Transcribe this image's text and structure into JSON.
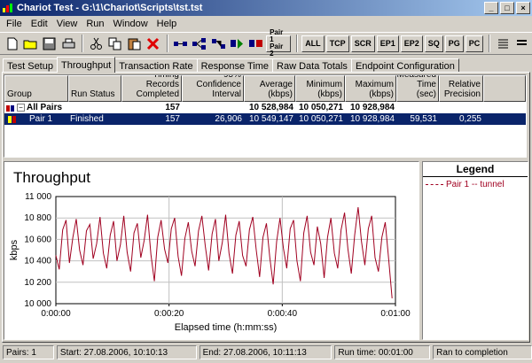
{
  "window": {
    "title": "Chariot Test - G:\\1\\Chariot\\Scripts\\tst.tst"
  },
  "menu": [
    "File",
    "Edit",
    "View",
    "Run",
    "Window",
    "Help"
  ],
  "toolbar": {
    "text_buttons": [
      "ALL",
      "TCP",
      "SCR",
      "EP1",
      "EP2",
      "SQ",
      "PG",
      "PC"
    ],
    "pair_label_1": "Pair 1",
    "pair_label_2": "Pair 2"
  },
  "tabs": [
    "Test Setup",
    "Throughput",
    "Transaction Rate",
    "Response Time",
    "Raw Data Totals",
    "Endpoint Configuration"
  ],
  "active_tab": "Throughput",
  "grid": {
    "headers": [
      "Group",
      "Run Status",
      "Timing Records Completed",
      "95% Confidence Interval",
      "Average (kbps)",
      "Minimum (kbps)",
      "Maximum (kbps)",
      "Measured Time (sec)",
      "Relative Precision"
    ],
    "total_row": {
      "group": "All Pairs",
      "run_status": "",
      "records": "157",
      "confidence": "",
      "average": "10 528,984",
      "minimum": "10 050,271",
      "maximum": "10 928,984",
      "measured": "",
      "precision": ""
    },
    "rows": [
      {
        "group": "Pair 1",
        "run_status": "Finished",
        "records": "157",
        "confidence": "26,906",
        "average": "10 549,147",
        "minimum": "10 050,271",
        "maximum": "10 928,984",
        "measured": "59,531",
        "precision": "0,255"
      }
    ]
  },
  "chart": {
    "title": "Throughput",
    "legend_title": "Legend",
    "line_color": "#a00020"
  },
  "chart_data": {
    "type": "line",
    "title": "Throughput",
    "xlabel": "Elapsed time (h:mm:ss)",
    "ylabel": "kbps",
    "ylim": [
      10000,
      11000
    ],
    "xlim": [
      0,
      60
    ],
    "yticks": [
      "11 000",
      "10 800",
      "10 600",
      "10 400",
      "10 200",
      "10 000"
    ],
    "xticks": [
      "0:00:00",
      "0:00:20",
      "0:00:40",
      "0:01:00"
    ],
    "grid": true,
    "series": [
      {
        "name": "Pair 1 -- tunnel",
        "x": [
          0.0,
          0.6,
          1.2,
          1.8,
          2.4,
          3.0,
          3.6,
          4.2,
          4.8,
          5.4,
          6.0,
          6.6,
          7.2,
          7.8,
          8.4,
          9.0,
          9.6,
          10.2,
          10.8,
          11.4,
          12.0,
          12.6,
          13.2,
          13.8,
          14.4,
          15.0,
          15.6,
          16.2,
          16.8,
          17.4,
          18.0,
          18.6,
          19.2,
          19.8,
          20.4,
          21.0,
          21.6,
          22.2,
          22.8,
          23.4,
          24.0,
          24.6,
          25.2,
          25.8,
          26.4,
          27.0,
          27.6,
          28.2,
          28.8,
          29.4,
          30.0,
          30.6,
          31.2,
          31.8,
          32.4,
          33.0,
          33.6,
          34.2,
          34.8,
          35.4,
          36.0,
          36.6,
          37.2,
          37.8,
          38.4,
          39.0,
          39.6,
          40.2,
          40.8,
          41.4,
          42.0,
          42.6,
          43.2,
          43.8,
          44.4,
          45.0,
          45.6,
          46.2,
          46.8,
          47.4,
          48.0,
          48.6,
          49.2,
          49.8,
          50.4,
          51.0,
          51.6,
          52.2,
          52.8,
          53.4,
          54.0,
          54.6,
          55.2,
          55.8,
          56.4,
          57.0,
          57.6,
          58.2,
          58.8,
          59.4
        ],
        "values": [
          10450,
          10320,
          10690,
          10780,
          10380,
          10620,
          10790,
          10500,
          10360,
          10680,
          10740,
          10420,
          10560,
          10810,
          10470,
          10330,
          10640,
          10770,
          10400,
          10550,
          10820,
          10480,
          10300,
          10660,
          10750,
          10430,
          10590,
          10830,
          10460,
          10210,
          10620,
          10780,
          10510,
          10380,
          10700,
          10800,
          10440,
          10260,
          10610,
          10760,
          10490,
          10350,
          10680,
          10820,
          10540,
          10310,
          10650,
          10790,
          10400,
          10570,
          10830,
          10470,
          10280,
          10640,
          10770,
          10450,
          10350,
          10690,
          10810,
          10500,
          10250,
          10620,
          10750,
          10430,
          10180,
          10580,
          10800,
          10520,
          10330,
          10700,
          10780,
          10400,
          10210,
          10660,
          10820,
          10480,
          10360,
          10720,
          10560,
          10240,
          10620,
          10800,
          10470,
          10330,
          10690,
          10850,
          10510,
          10280,
          10640,
          10900,
          10580,
          10360,
          10700,
          10820,
          10430,
          10300,
          10620,
          10760,
          10420,
          10050
        ]
      }
    ]
  },
  "status": {
    "pairs": "Pairs: 1",
    "start": "Start: 27.08.2006, 10:10:13",
    "end": "End: 27.08.2006, 10:11:13",
    "run_time": "Run time: 00:01:00",
    "state": "Ran to completion"
  }
}
